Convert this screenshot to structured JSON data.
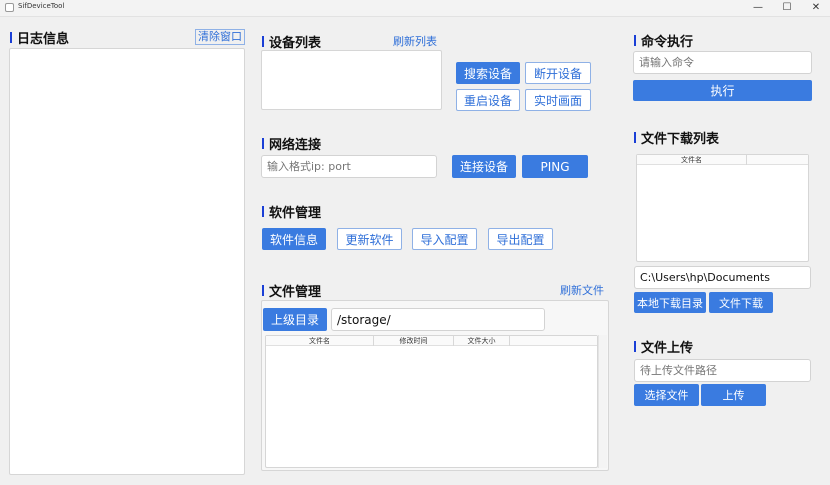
{
  "app": {
    "title": "SifDeviceTool",
    "icon": "app-icon"
  },
  "window_controls": {
    "minimize": "—",
    "maximize": "☐",
    "close": "✕"
  },
  "log": {
    "title": "日志信息",
    "clear_label": "清除窗口"
  },
  "devices": {
    "title": "设备列表",
    "refresh_label": "刷新列表",
    "search_label": "搜索设备",
    "disconnect_label": "断开设备",
    "reboot_label": "重启设备",
    "live_label": "实时画面"
  },
  "network": {
    "title": "网络连接",
    "ip_placeholder": "输入格式ip: port",
    "connect_label": "连接设备",
    "ping_label": "PING"
  },
  "software": {
    "title": "软件管理",
    "info_label": "软件信息",
    "update_label": "更新软件",
    "import_label": "导入配置",
    "export_label": "导出配置"
  },
  "files": {
    "title": "文件管理",
    "refresh_label": "刷新文件",
    "up_label": "上级目录",
    "path": "/storage/",
    "columns": [
      "文件名",
      "修改时间",
      "文件大小"
    ]
  },
  "command": {
    "title": "命令执行",
    "input_placeholder": "请输入命令",
    "execute_label": "执行"
  },
  "download": {
    "title": "文件下载列表",
    "columns": [
      "文件名",
      ""
    ],
    "local_path": "C:\\Users\\hp\\Documents",
    "local_dir_label": "本地下载目录",
    "download_label": "文件下载"
  },
  "upload": {
    "title": "文件上传",
    "path_placeholder": "待上传文件路径",
    "choose_label": "选择文件",
    "upload_label": "上传"
  }
}
